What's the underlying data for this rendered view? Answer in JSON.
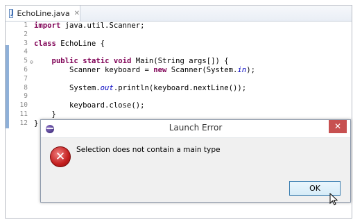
{
  "editor": {
    "tab": {
      "label": "EchoLine.java",
      "close_glyph": "✕"
    },
    "lines": [
      {
        "num": "1",
        "segments": [
          {
            "t": "import",
            "c": "kw"
          },
          {
            "t": " java.util.Scanner;"
          }
        ]
      },
      {
        "num": "2",
        "segments": []
      },
      {
        "num": "3",
        "segments": [
          {
            "t": "class",
            "c": "kw"
          },
          {
            "t": " EchoLine {"
          }
        ]
      },
      {
        "num": "4",
        "segments": []
      },
      {
        "num": "5",
        "fold": "⊖",
        "segments": [
          {
            "t": "    "
          },
          {
            "t": "public",
            "c": "kw"
          },
          {
            "t": " "
          },
          {
            "t": "static",
            "c": "kw"
          },
          {
            "t": " "
          },
          {
            "t": "void",
            "c": "kw"
          },
          {
            "t": " Main(String args[]) {"
          }
        ]
      },
      {
        "num": "6",
        "segments": [
          {
            "t": "        Scanner keyboard = "
          },
          {
            "t": "new",
            "c": "kw"
          },
          {
            "t": " Scanner(System."
          },
          {
            "t": "in",
            "c": "it"
          },
          {
            "t": ");"
          }
        ]
      },
      {
        "num": "7",
        "segments": []
      },
      {
        "num": "8",
        "segments": [
          {
            "t": "        System."
          },
          {
            "t": "out",
            "c": "it"
          },
          {
            "t": ".println(keyboard.nextLine());"
          }
        ]
      },
      {
        "num": "9",
        "segments": []
      },
      {
        "num": "10",
        "segments": [
          {
            "t": "        keyboard.close();"
          }
        ]
      },
      {
        "num": "11",
        "segments": [
          {
            "t": "    }"
          }
        ]
      },
      {
        "num": "12",
        "segments": [
          {
            "t": "}"
          }
        ]
      }
    ]
  },
  "dialog": {
    "title": "Launch Error",
    "close_glyph": "✕",
    "error_glyph": "✕",
    "message": "Selection does not contain a main type",
    "ok_label": "OK"
  },
  "colors": {
    "keyword": "#7f0055",
    "static_field": "#0000c0",
    "close_button": "#c75050",
    "error_icon": "#c41f1f"
  },
  "icons": [
    "java-file-icon",
    "fold-collapse-icon",
    "app-icon",
    "error-icon",
    "mouse-pointer-icon"
  ]
}
